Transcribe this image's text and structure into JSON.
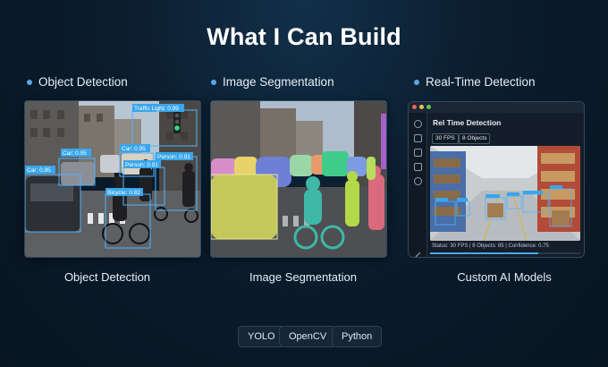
{
  "page": {
    "title": "What I Can Build"
  },
  "sections": [
    {
      "label": "Object Detection",
      "caption": "Object Detection"
    },
    {
      "label": "Image Segmentation",
      "caption": "Image Segmentation"
    },
    {
      "label": "Real-Time Detection",
      "caption": "Custom AI Models"
    }
  ],
  "object_detection": {
    "boxes": [
      {
        "label": "Traffic Light: 0.99"
      },
      {
        "label": "Car: 0.95"
      },
      {
        "label": "Car: 0.95"
      },
      {
        "label": "Car: 0.95"
      },
      {
        "label": "Person: 0.91"
      },
      {
        "label": "Person: 0.91"
      },
      {
        "label": "Bicycle: 0.82"
      }
    ]
  },
  "app": {
    "title": "Rel Time Detection",
    "fps_badge": "30 FPS",
    "objects_badge": "8 Objects",
    "status": "Status: 30 FPS  |  8 Objects: 85  |  Confidence: 0.75"
  },
  "tech_chips": [
    "YOLO",
    "OpenCV",
    "Python"
  ],
  "colors": {
    "accent": "#5aa7e6",
    "box": "#4fb4ff",
    "background": "#0b1c2c"
  }
}
